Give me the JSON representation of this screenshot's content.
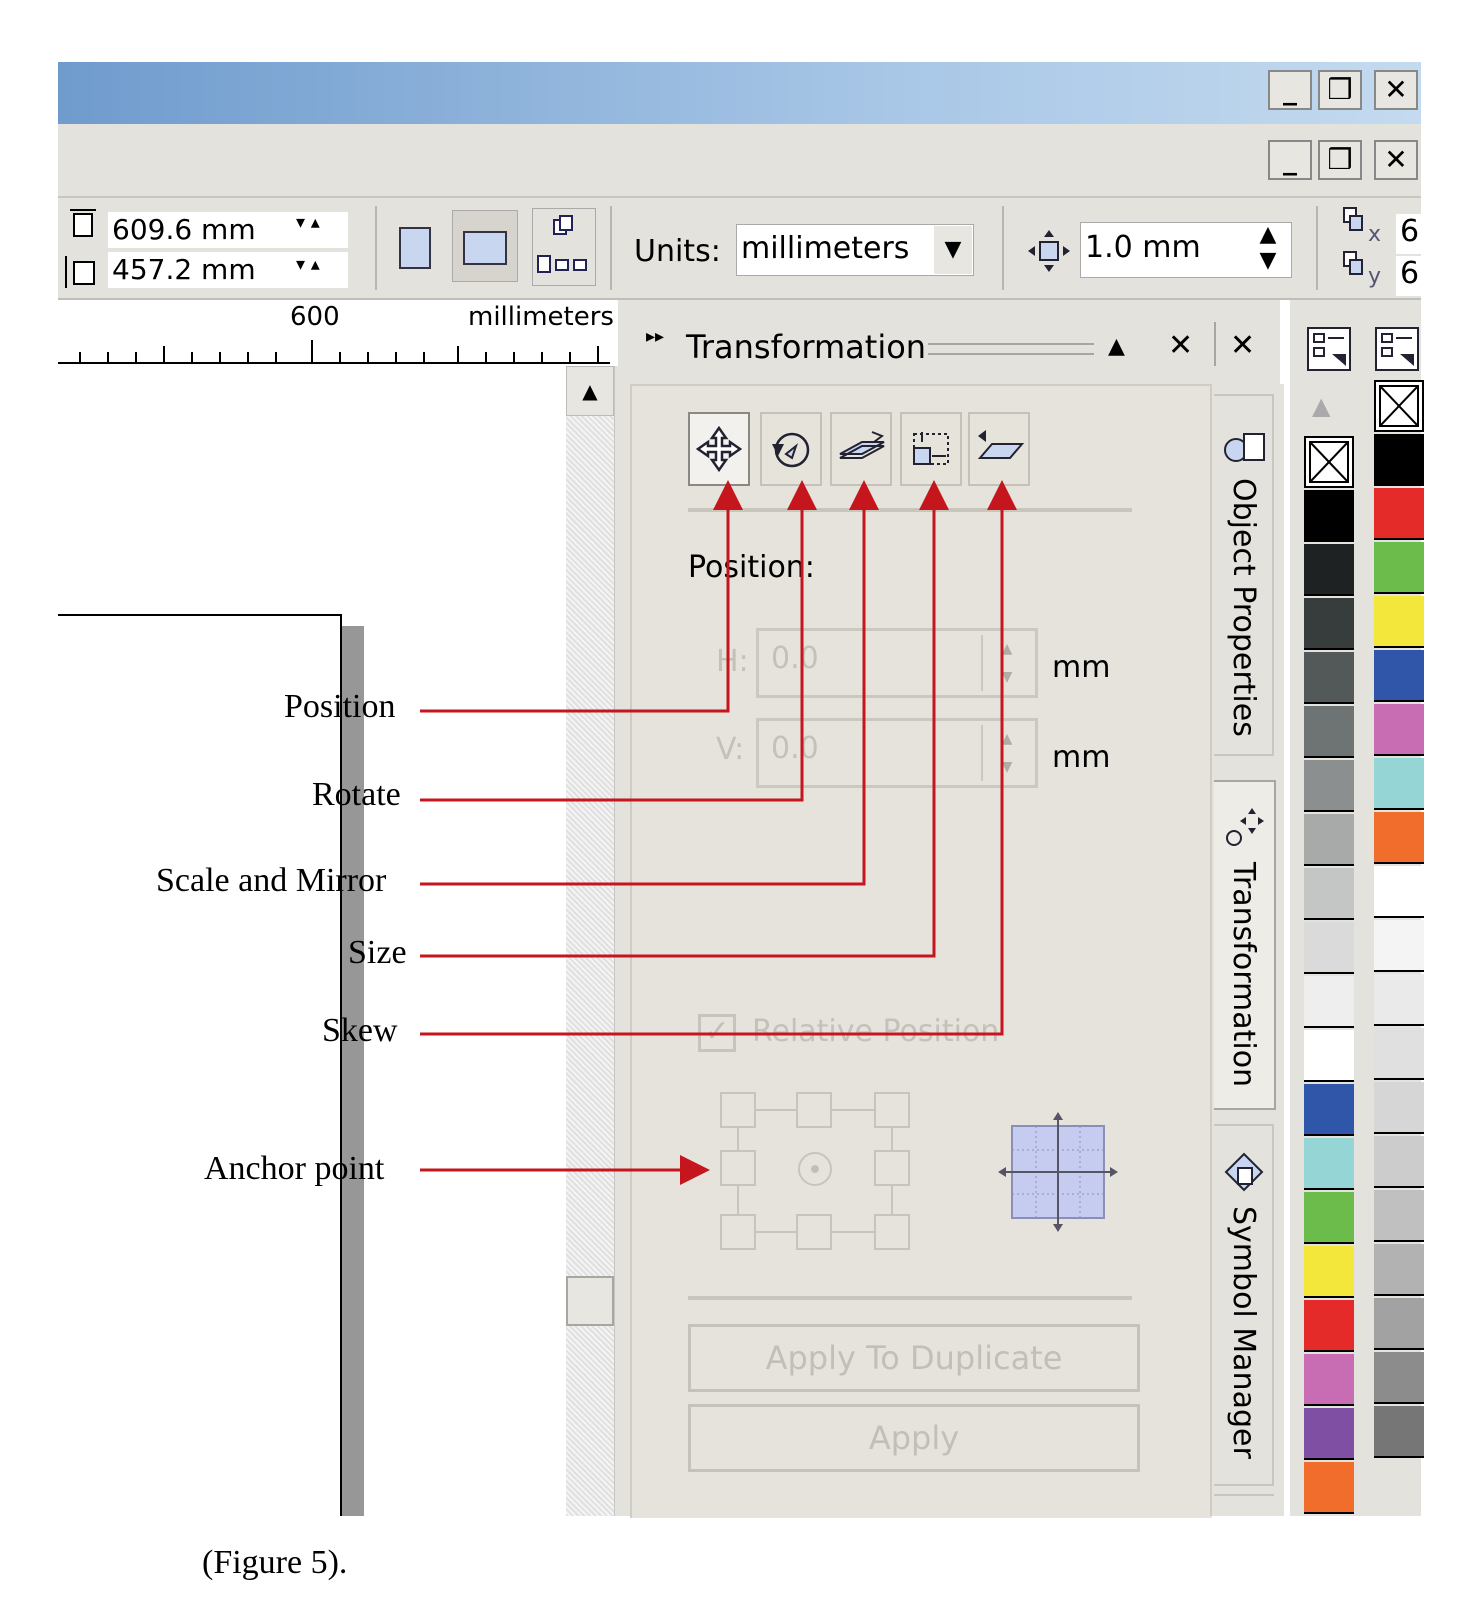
{
  "window": {
    "minimize": "_",
    "restore": "❒",
    "close": "✕"
  },
  "propertybar": {
    "width": "609.6 mm",
    "height": "457.2 mm",
    "units_label": "Units:",
    "units_value": "millimeters",
    "nudge": "1.0 mm",
    "dup_x_sub": "x",
    "dup_y_sub": "y",
    "dup_x_value": "6",
    "dup_y_value": "6"
  },
  "ruler": {
    "tick_label": "600",
    "unit_label": "millimeters"
  },
  "docker": {
    "title": "Transformation",
    "tabs": [
      {
        "name": "Position",
        "icon": "move-icon"
      },
      {
        "name": "Rotate",
        "icon": "rotate-icon"
      },
      {
        "name": "Scale and Mirror",
        "icon": "scale-mirror-icon"
      },
      {
        "name": "Size",
        "icon": "size-icon"
      },
      {
        "name": "Skew",
        "icon": "skew-icon"
      }
    ],
    "section_label": "Position:",
    "h_label": "H:",
    "h_value": "0.0",
    "h_unit": "mm",
    "v_label": "V:",
    "v_value": "0.0",
    "v_unit": "mm",
    "relative_position": "Relative Position",
    "apply_to_duplicate": "Apply To Duplicate",
    "apply": "Apply"
  },
  "side_tabs": [
    "Object Properties",
    "Transformation",
    "Symbol Manager"
  ],
  "palette_left": [
    "#000000",
    "#1e2222",
    "#373d3d",
    "#535858",
    "#6e7373",
    "#8c8f8f",
    "#a8aaaa",
    "#c4c5c5",
    "#dadada",
    "#eeeeee",
    "#ffffff",
    "#2f56a8",
    "#95d5d5",
    "#6bbc4b",
    "#f2e73a",
    "#e52a2a",
    "#c86cb3",
    "#7f4fa4",
    "#f06d2b"
  ],
  "palette_right": [
    "#000000",
    "#e52a2a",
    "#6bbc4b",
    "#f2e73a",
    "#2f56a8",
    "#c86cb3",
    "#95d5d5",
    "#f06d2b",
    "#ffffff",
    "#f4f4f4",
    "#eaeaea",
    "#e0e0e0",
    "#d6d6d6",
    "#cccccc",
    "#c0c0c0",
    "#b2b2b2",
    "#a2a2a2",
    "#8c8c8c",
    "#767676"
  ],
  "annotations": {
    "position": "Position",
    "rotate": "Rotate",
    "scale_mirror": "Scale and Mirror",
    "size": "Size",
    "skew": "Skew",
    "anchor": "Anchor point",
    "arrow_color": "#c4161c"
  },
  "caption": "(Figure 5)."
}
